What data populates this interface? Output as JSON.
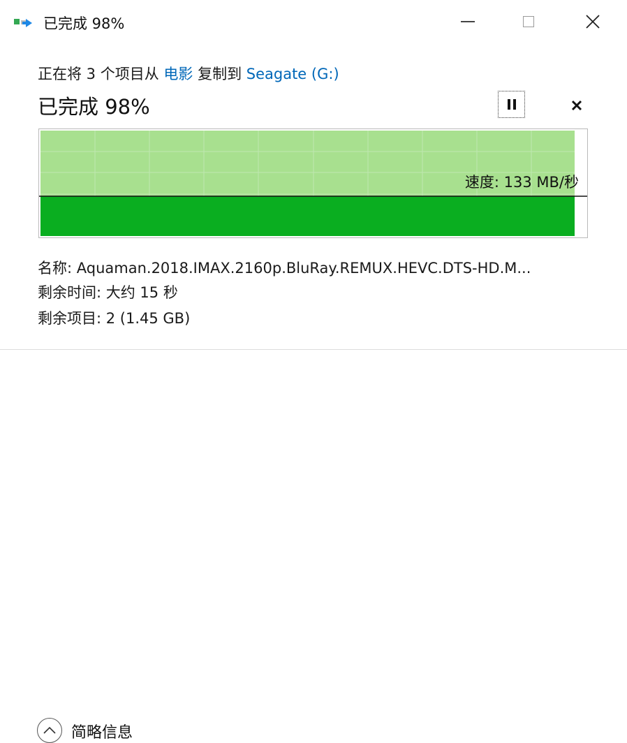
{
  "window": {
    "title": "已完成 98%",
    "icon": "copy-files-icon"
  },
  "copy": {
    "prefix": "正在将 3 个项目从 ",
    "source": "电影",
    "middle": " 复制到 ",
    "destination": "Seagate (G:)"
  },
  "progress": {
    "status": "已完成 98%",
    "percent": 98,
    "speed_label": "速度: 133 MB/秒"
  },
  "details": {
    "name": "名称: Aquaman.2018.IMAX.2160p.BluRay.REMUX.HEVC.DTS-HD.M...",
    "time_remaining": "剩余时间: 大约 15 秒",
    "items_remaining": "剩余项目: 2 (1.45 GB)"
  },
  "footer": {
    "fewer_details": "简略信息"
  },
  "colors": {
    "link": "#0067b8",
    "progress_light": "#a8e08f",
    "progress_dark": "#0aae20",
    "grid": "#bfe8b0"
  }
}
